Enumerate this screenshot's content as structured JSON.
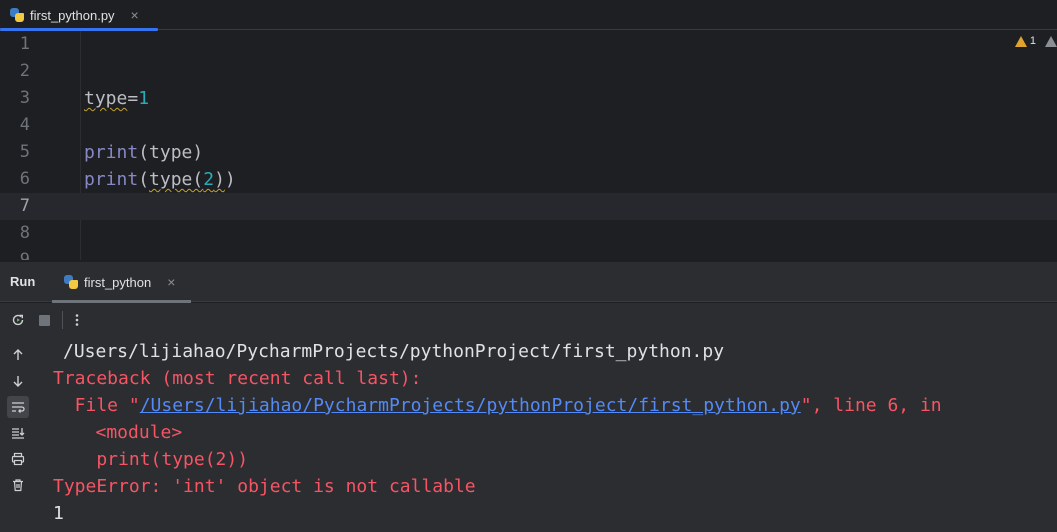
{
  "editor_tab": {
    "filename": "first_python.py",
    "close": "×"
  },
  "inspections": {
    "warning_count": "1"
  },
  "editor": {
    "lines": [
      {
        "num": "1",
        "code": ""
      },
      {
        "num": "2",
        "code": ""
      },
      {
        "num": "3",
        "code": "type=1"
      },
      {
        "num": "4",
        "code": ""
      },
      {
        "num": "5",
        "code": "print(type)"
      },
      {
        "num": "6",
        "code": "print(type(2))"
      },
      {
        "num": "7",
        "code": ""
      },
      {
        "num": "8",
        "code": ""
      },
      {
        "num": "9",
        "code": ""
      }
    ],
    "current_line": "7"
  },
  "run_panel": {
    "title": "Run",
    "tab_label": "first_python",
    "tab_close": "×"
  },
  "console": {
    "command": "/Users/lijiahao/PycharmProjects/pythonProject/first_python.py",
    "traceback_header": "Traceback (most recent call last):",
    "file_prefix": "  File \"",
    "file_link": "/Users/lijiahao/PycharmProjects/pythonProject/first_python.py",
    "file_suffix": "\", line 6, in",
    "module_line": "   <module>",
    "code_line": "    print(type(2))",
    "error_line": "TypeError: 'int' object is not callable",
    "output_line": "1"
  },
  "colors": {
    "background": "#1e1f22",
    "panel": "#2b2d30",
    "accent": "#3574f0",
    "error": "#f75464",
    "link": "#548af7",
    "number": "#2aacb8",
    "builtin": "#8888c6",
    "warning": "#e0a32e"
  }
}
